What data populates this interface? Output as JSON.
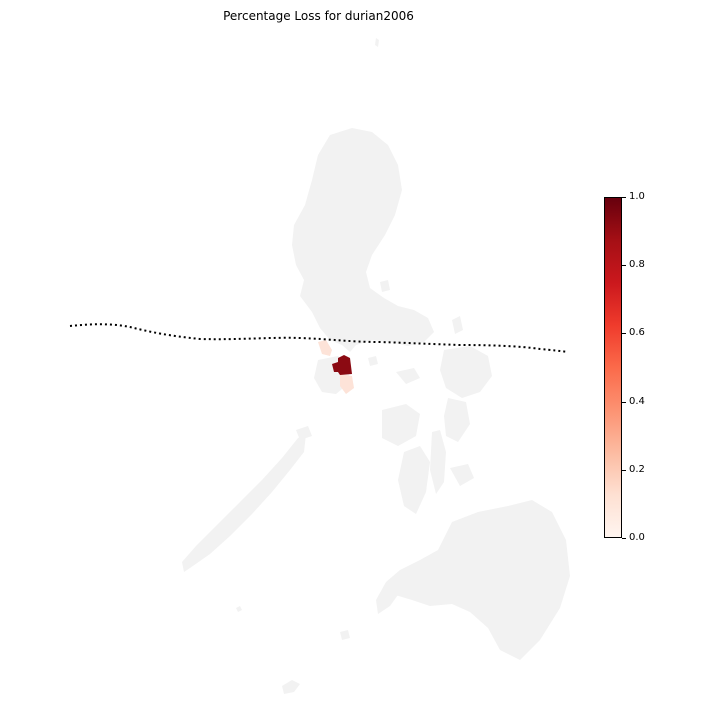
{
  "title": "Percentage Loss for durian2006",
  "colorbar": {
    "colormap": "Reds",
    "min": 0.0,
    "max": 1.0,
    "ticks": [
      "0.0",
      "0.2",
      "0.4",
      "0.6",
      "0.8",
      "1.0"
    ]
  },
  "map": {
    "land_color": "#f2f2f2",
    "track_style": "dotted black",
    "affected_areas": [
      {
        "loss": 0.9,
        "color": "#8b0a12"
      },
      {
        "loss": 0.15,
        "color": "#fde3d8"
      }
    ]
  }
}
